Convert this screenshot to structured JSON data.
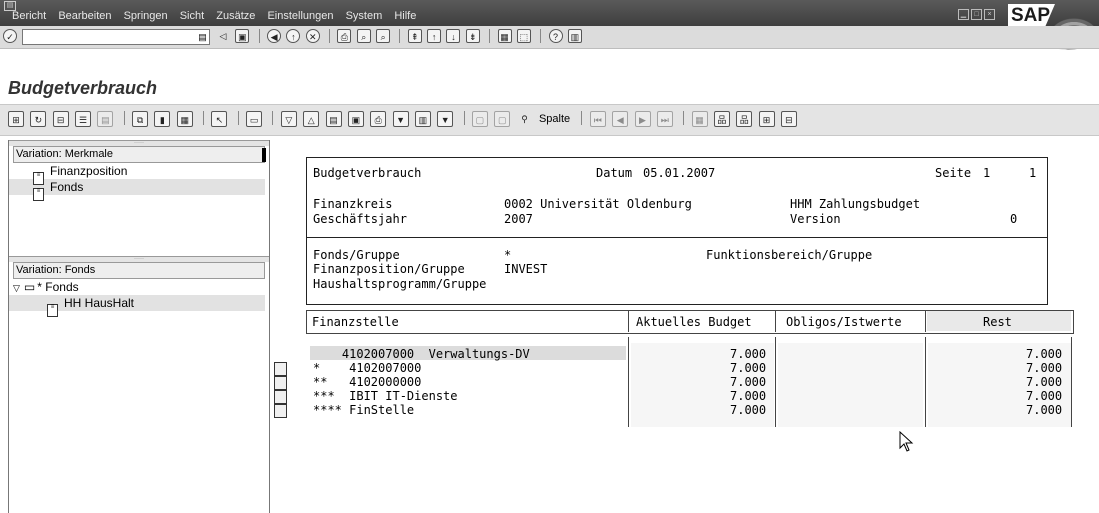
{
  "menu": [
    "Bericht",
    "Bearbeiten",
    "Springen",
    "Sicht",
    "Zusätze",
    "Einstellungen",
    "System",
    "Hilfe"
  ],
  "brand": "SAP",
  "command_field": "",
  "title": "Budgetverbrauch",
  "toolbar2": {
    "spalte": "Spalte"
  },
  "left": {
    "variation1_title": "Variation: Merkmale",
    "variation1_items": [
      "Finanzposition",
      "Fonds"
    ],
    "variation2_title": "Variation: Fonds",
    "tree_root": "* Fonds",
    "tree_child": "HH HausHalt"
  },
  "report": {
    "header_title": "Budgetverbrauch",
    "datum_label": "Datum",
    "datum": "05.01.2007",
    "seite_label": "Seite",
    "seite_a": "1",
    "seite_b": "1",
    "finanzkreis_label": "Finanzkreis",
    "finanzkreis_value": "0002 Universität Oldenburg",
    "finanzkreis_extra": "HHM Zahlungsbudget",
    "geschaeftsjahr_label": "Geschäftsjahr",
    "geschaeftsjahr_value": "2007",
    "version_label": "Version",
    "version_value": "0",
    "fonds_label": "Fonds/Gruppe",
    "fonds_value": "*",
    "funktionsbereich_label": "Funktionsbereich/Gruppe",
    "finanzposition_label": "Finanzposition/Gruppe",
    "finanzposition_value": "INVEST",
    "haushaltsprogramm_label": "Haushaltsprogramm/Gruppe",
    "columns": [
      "Finanzstelle",
      "Aktuelles Budget",
      "Obligos/Istwerte",
      "Rest"
    ],
    "rows": [
      {
        "label": "    4102007000  Verwaltungs-DV",
        "budget": "7.000",
        "obligo": "",
        "rest": "7.000"
      },
      {
        "label": "*    4102007000",
        "budget": "7.000",
        "obligo": "",
        "rest": "7.000"
      },
      {
        "label": "**   4102000000",
        "budget": "7.000",
        "obligo": "",
        "rest": "7.000"
      },
      {
        "label": "***  IBIT IT-Dienste",
        "budget": "7.000",
        "obligo": "",
        "rest": "7.000"
      },
      {
        "label": "**** FinStelle",
        "budget": "7.000",
        "obligo": "",
        "rest": "7.000"
      }
    ]
  }
}
